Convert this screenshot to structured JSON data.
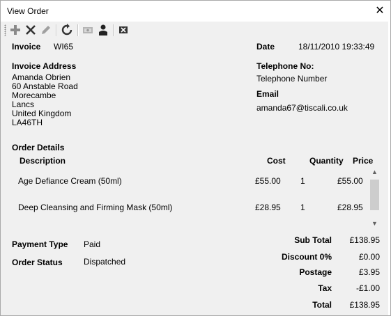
{
  "window": {
    "title": "View Order",
    "close_glyph": "✕"
  },
  "toolbar": {
    "buttons": [
      "add-icon",
      "delete-icon",
      "edit-icon",
      "refresh-icon",
      "payment-icon",
      "customer-icon",
      "close-form-icon"
    ]
  },
  "invoice": {
    "label": "Invoice",
    "value": "WI65"
  },
  "date": {
    "label": "Date",
    "value": "18/11/2010 19:33:49"
  },
  "address": {
    "label": "Invoice Address",
    "lines": [
      "Amanda Obrien",
      "60 Anstable Road",
      "Morecambe",
      "Lancs",
      "United Kingdom",
      "LA46TH"
    ]
  },
  "telephone": {
    "label": "Telephone No:",
    "value": "Telephone Number"
  },
  "email": {
    "label": "Email",
    "value": "amanda67@tiscali.co.uk"
  },
  "order_details": {
    "label": "Order Details",
    "columns": {
      "description": "Description",
      "cost": "Cost",
      "quantity": "Quantity",
      "price": "Price"
    },
    "rows": [
      {
        "description": "Age Defiance Cream (50ml)",
        "cost": "£55.00",
        "quantity": "1",
        "price": "£55.00"
      },
      {
        "description": "Deep Cleansing and Firming Mask (50ml)",
        "cost": "£28.95",
        "quantity": "1",
        "price": "£28.95"
      }
    ]
  },
  "payment_type": {
    "label": "Payment Type",
    "value": "Paid"
  },
  "order_status": {
    "label": "Order Status",
    "value": "Dispatched"
  },
  "totals": {
    "sub_total_label": "Sub Total",
    "sub_total": "£138.95",
    "discount_label": "Discount 0%",
    "discount": "£0.00",
    "postage_label": "Postage",
    "postage": "£3.95",
    "tax_label": "Tax",
    "tax": "-£1.00",
    "total_label": "Total",
    "total": "£138.95"
  },
  "scrollbar": {
    "up_glyph": "▲",
    "down_glyph": "▼"
  }
}
